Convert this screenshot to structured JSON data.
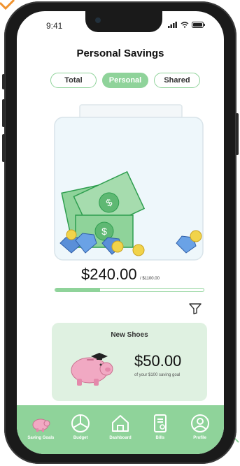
{
  "status": {
    "time": "9:41"
  },
  "page_title": "Personal Savings",
  "tabs": [
    {
      "label": "Total",
      "active": false
    },
    {
      "label": "Personal",
      "active": true
    },
    {
      "label": "Shared",
      "active": false
    }
  ],
  "jar": {
    "current_amount": "$240.00",
    "goal_amount": "/ $1100.00",
    "progress_fraction": 0.3
  },
  "goal_card": {
    "title": "New Shoes",
    "amount": "$50.00",
    "subtitle": "of your $100 saving goal"
  },
  "nav": [
    {
      "label": "Saving Goals",
      "icon": "piggy-bank-icon"
    },
    {
      "label": "Budget",
      "icon": "pie-chart-icon"
    },
    {
      "label": "Dashboard",
      "icon": "home-icon"
    },
    {
      "label": "Bills",
      "icon": "bill-icon"
    },
    {
      "label": "Profile",
      "icon": "profile-icon"
    }
  ],
  "colors": {
    "accent": "#8fd39a",
    "card_bg": "#dff1e1",
    "jar_bg": "#eef7fb"
  }
}
